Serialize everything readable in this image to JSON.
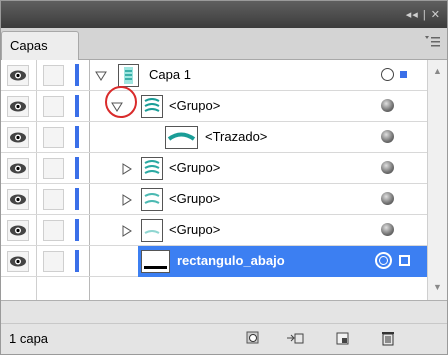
{
  "window": {
    "title_buttons": "◂◂ | ✕"
  },
  "tabs": [
    {
      "label": "Capas"
    }
  ],
  "layers": [
    {
      "name": "Capa 1",
      "level": 0,
      "expanded": true,
      "selected": false
    },
    {
      "name": "<Grupo>",
      "level": 1,
      "expanded": true,
      "selected": false
    },
    {
      "name": "<Trazado>",
      "level": 2,
      "expanded": false,
      "selected": false
    },
    {
      "name": "<Grupo>",
      "level": 1,
      "expanded": false,
      "selected": false
    },
    {
      "name": "<Grupo>",
      "level": 1,
      "expanded": false,
      "selected": false
    },
    {
      "name": "<Grupo>",
      "level": 1,
      "expanded": false,
      "selected": false
    },
    {
      "name": "rectangulo_abajo",
      "level": 1,
      "expanded": false,
      "selected": true
    }
  ],
  "footer": {
    "count_label": "1 capa"
  },
  "colors": {
    "layer_color": "#3a6fe8",
    "selection": "#3c7ff2",
    "callout": "#d92b2b"
  },
  "icons": [
    "eye-icon",
    "disclosure-triangle-icon",
    "target-circle-icon",
    "panel-menu-icon",
    "make-clipping-mask-icon",
    "new-sublayer-icon",
    "new-layer-icon",
    "trash-icon"
  ]
}
